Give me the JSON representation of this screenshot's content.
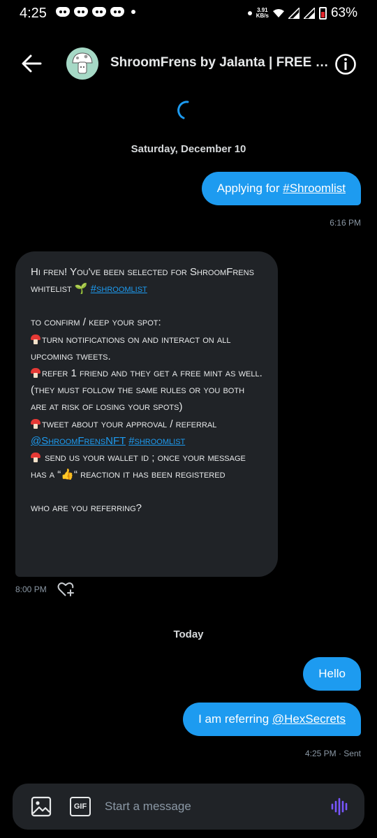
{
  "status_bar": {
    "time": "4:25",
    "net_speed_value": "3.91",
    "net_speed_unit": "KB/s",
    "battery": "63%"
  },
  "header": {
    "title": "ShroomFrens by Jalanta | FREE MINT"
  },
  "date_separators": {
    "first": "Saturday, December 10",
    "second": "Today"
  },
  "messages": {
    "m1": {
      "prefix": "Applying for ",
      "hashtag": "#Shroomlist",
      "time": "6:16 PM"
    },
    "incoming": {
      "line1a": "Hi fren! You've been selected for ShroomFrens whitelist ",
      "sprout": "🌱",
      "line1_tag": "#shroomlist",
      "line2": "to confirm / keep your spot:",
      "item1": "turn notifications on and interact on all upcoming tweets.",
      "item2": "refer 1 friend and they get a free mint as well. (they must follow the same rules or you both are at risk of losing your spots)",
      "item3a": "tweet about your approval / referral ",
      "item3_mention": "@ShroomFrensNFT",
      "item3_tag": "#shroomlist",
      "item4a": " send us your wallet id ; once your message has a “",
      "thumbs": "👍",
      "item4b": "“ reaction it has been registered",
      "question": " who are you referring?",
      "time": "8:00 PM"
    },
    "m2": {
      "text": "Hello"
    },
    "m3": {
      "prefix": "I am referring ",
      "mention": "@HexSecrets",
      "meta": "4:25 PM · Sent"
    }
  },
  "composer": {
    "gif_label": "GIF",
    "placeholder": "Start a message"
  },
  "colors": {
    "accent": "#1d9bf0",
    "bubble_in": "#202327",
    "voice": "#7856ff"
  },
  "icons": [
    "back-arrow-icon",
    "info-icon",
    "image-icon",
    "gif-icon",
    "voice-icon",
    "heart-plus-icon",
    "loading-spinner-icon"
  ]
}
